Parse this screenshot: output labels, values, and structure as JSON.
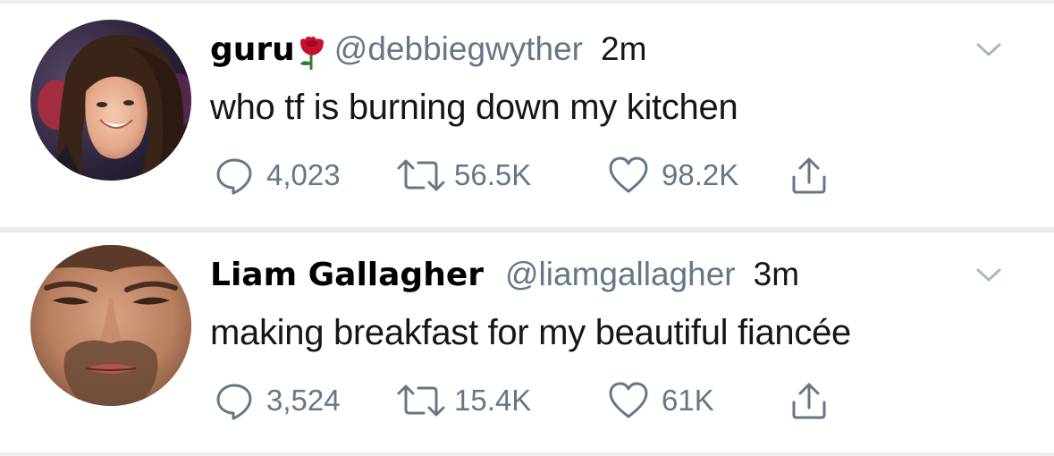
{
  "tweets": [
    {
      "display_name": "guru",
      "name_emoji": "rose-emoji",
      "handle": "@debbiegwyther",
      "time": "2m",
      "text": "who tf is burning down my kitchen",
      "replies": "4,023",
      "retweets": "56.5K",
      "likes": "98.2K"
    },
    {
      "display_name": "Liam Gallagher",
      "handle": "@liamgallagher",
      "time": "3m",
      "text": "making breakfast for my beautiful fiancée",
      "replies": "3,524",
      "retweets": "15.4K",
      "likes": "61K"
    }
  ],
  "icons": {
    "reply": "speech-bubble-icon",
    "retweet": "retweet-icon",
    "like": "heart-icon",
    "share": "share-icon",
    "menu": "chevron-down-icon"
  },
  "colors": {
    "secondary_text": "#657786",
    "primary_text": "#14171a",
    "divider": "#e6ecf0",
    "rose": "#c8102e"
  }
}
